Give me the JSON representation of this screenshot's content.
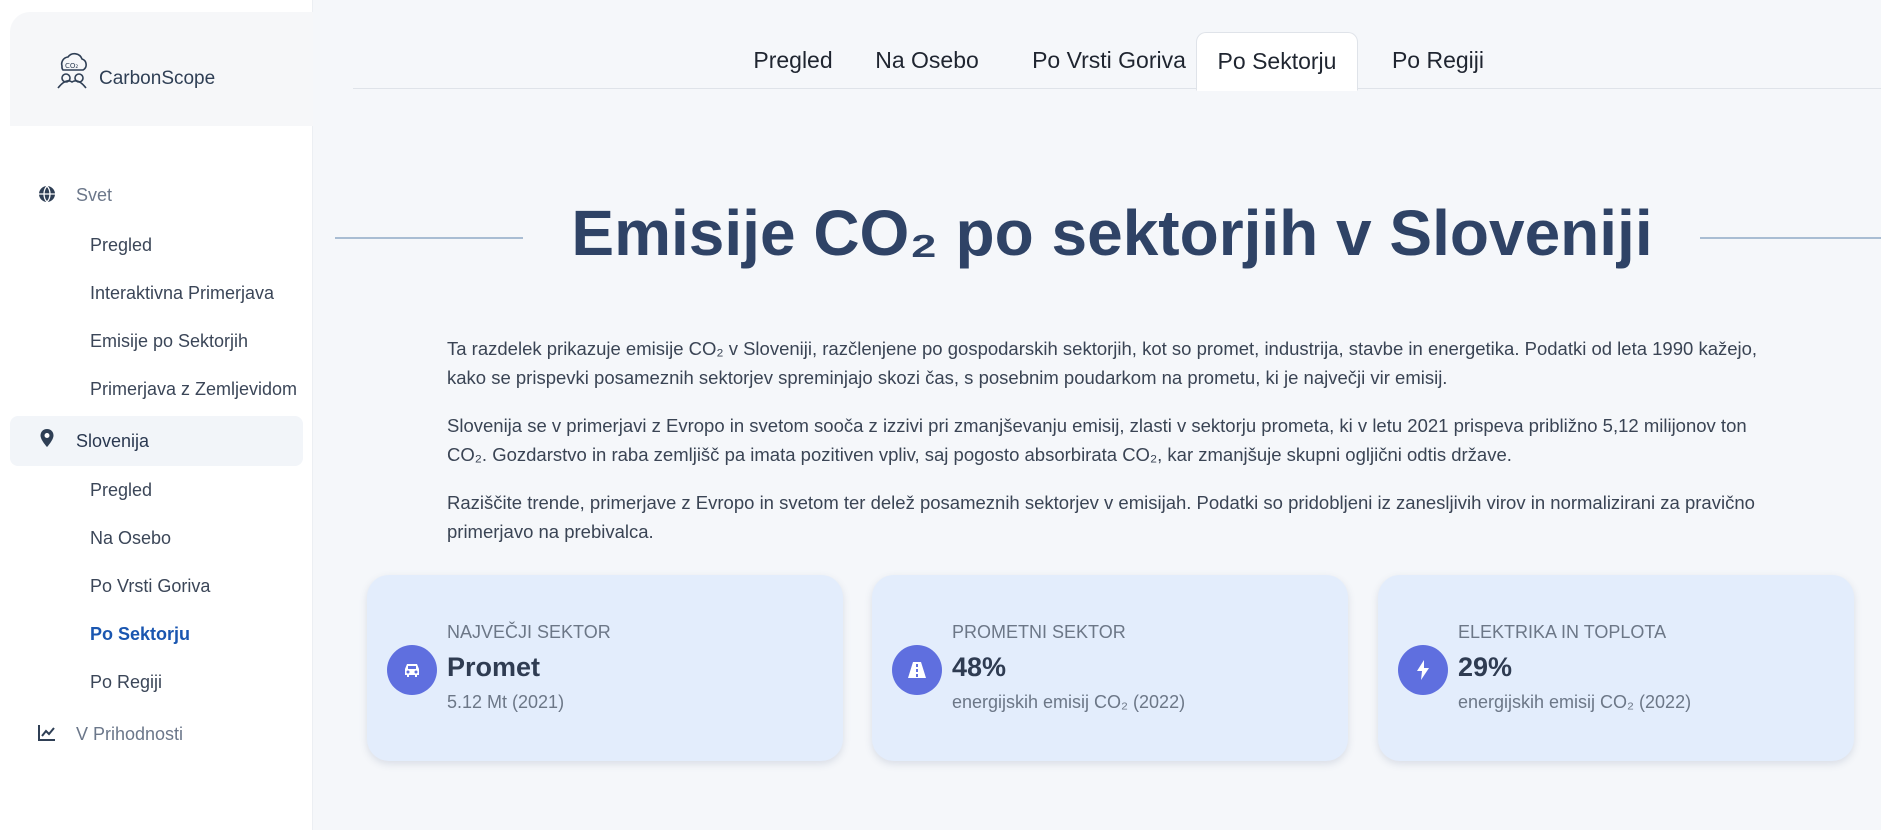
{
  "brand": {
    "name": "CarbonScope",
    "logo_icon": "co2-logo-icon"
  },
  "sidebar": {
    "sections": [
      {
        "label": "Svet",
        "icon": "globe-icon",
        "items": [
          "Pregled",
          "Interaktivna Primerjava",
          "Emisije po Sektorjih",
          "Primerjava z Zemljevidom"
        ]
      },
      {
        "label": "Slovenija",
        "icon": "map-pin-icon",
        "items": [
          "Pregled",
          "Na Osebo",
          "Po Vrsti Goriva",
          "Po Sektorju",
          "Po Regiji"
        ]
      },
      {
        "label": "V Prihodnosti",
        "icon": "chart-line-icon",
        "items": []
      }
    ],
    "active_section": "Slovenija",
    "active_item": "Po Sektorju"
  },
  "tabs": [
    {
      "label": "Pregled"
    },
    {
      "label": "Na Osebo"
    },
    {
      "label": "Po Vrsti Goriva"
    },
    {
      "label": "Po Sektorju"
    },
    {
      "label": "Po Regiji"
    }
  ],
  "active_tab": "Po Sektorju",
  "main": {
    "title": "Emisije CO₂ po sektorjih v Sloveniji",
    "paragraphs": [
      "Ta razdelek prikazuje emisije CO₂ v Sloveniji, razčlenjene po gospodarskih sektorjih, kot so promet, industrija, stavbe in energetika. Podatki od leta 1990 kažejo, kako se prispevki posameznih sektorjev spreminjajo skozi čas, s posebnim poudarkom na prometu, ki je največji vir emisij.",
      "Slovenija se v primerjavi z Evropo in svetom sooča z izzivi pri zmanjševanju emisij, zlasti v sektorju prometa, ki v letu 2021 prispeva približno 5,12 milijonov ton CO₂. Gozdarstvo in raba zemljišč pa imata pozitiven vpliv, saj pogosto absorbirata CO₂, kar zmanjšuje skupni ogljični odtis države.",
      "Raziščite trende, primerjave z Evropo in svetom ter delež posameznih sektorjev v emisijah. Podatki so pridobljeni iz zanesljivih virov in normalizirani za pravično primerjavo na prebivalca."
    ]
  },
  "cards": [
    {
      "label": "NAJVEČJI SEKTOR",
      "value": "Promet",
      "note": "5.12 Mt (2021)",
      "icon": "car-icon"
    },
    {
      "label": "PROMETNI SEKTOR",
      "value": "48%",
      "note": "energijskih emisij CO₂ (2022)",
      "icon": "road-icon"
    },
    {
      "label": "ELEKTRIKA IN TOPLOTA",
      "value": "29%",
      "note": "energijskih emisij CO₂ (2022)",
      "icon": "lightning-icon"
    }
  ],
  "colors": {
    "accent": "#1a56b0",
    "title": "#2f4366",
    "card_bg": "#e3edfc",
    "icon_circle": "#5f6fdf"
  }
}
